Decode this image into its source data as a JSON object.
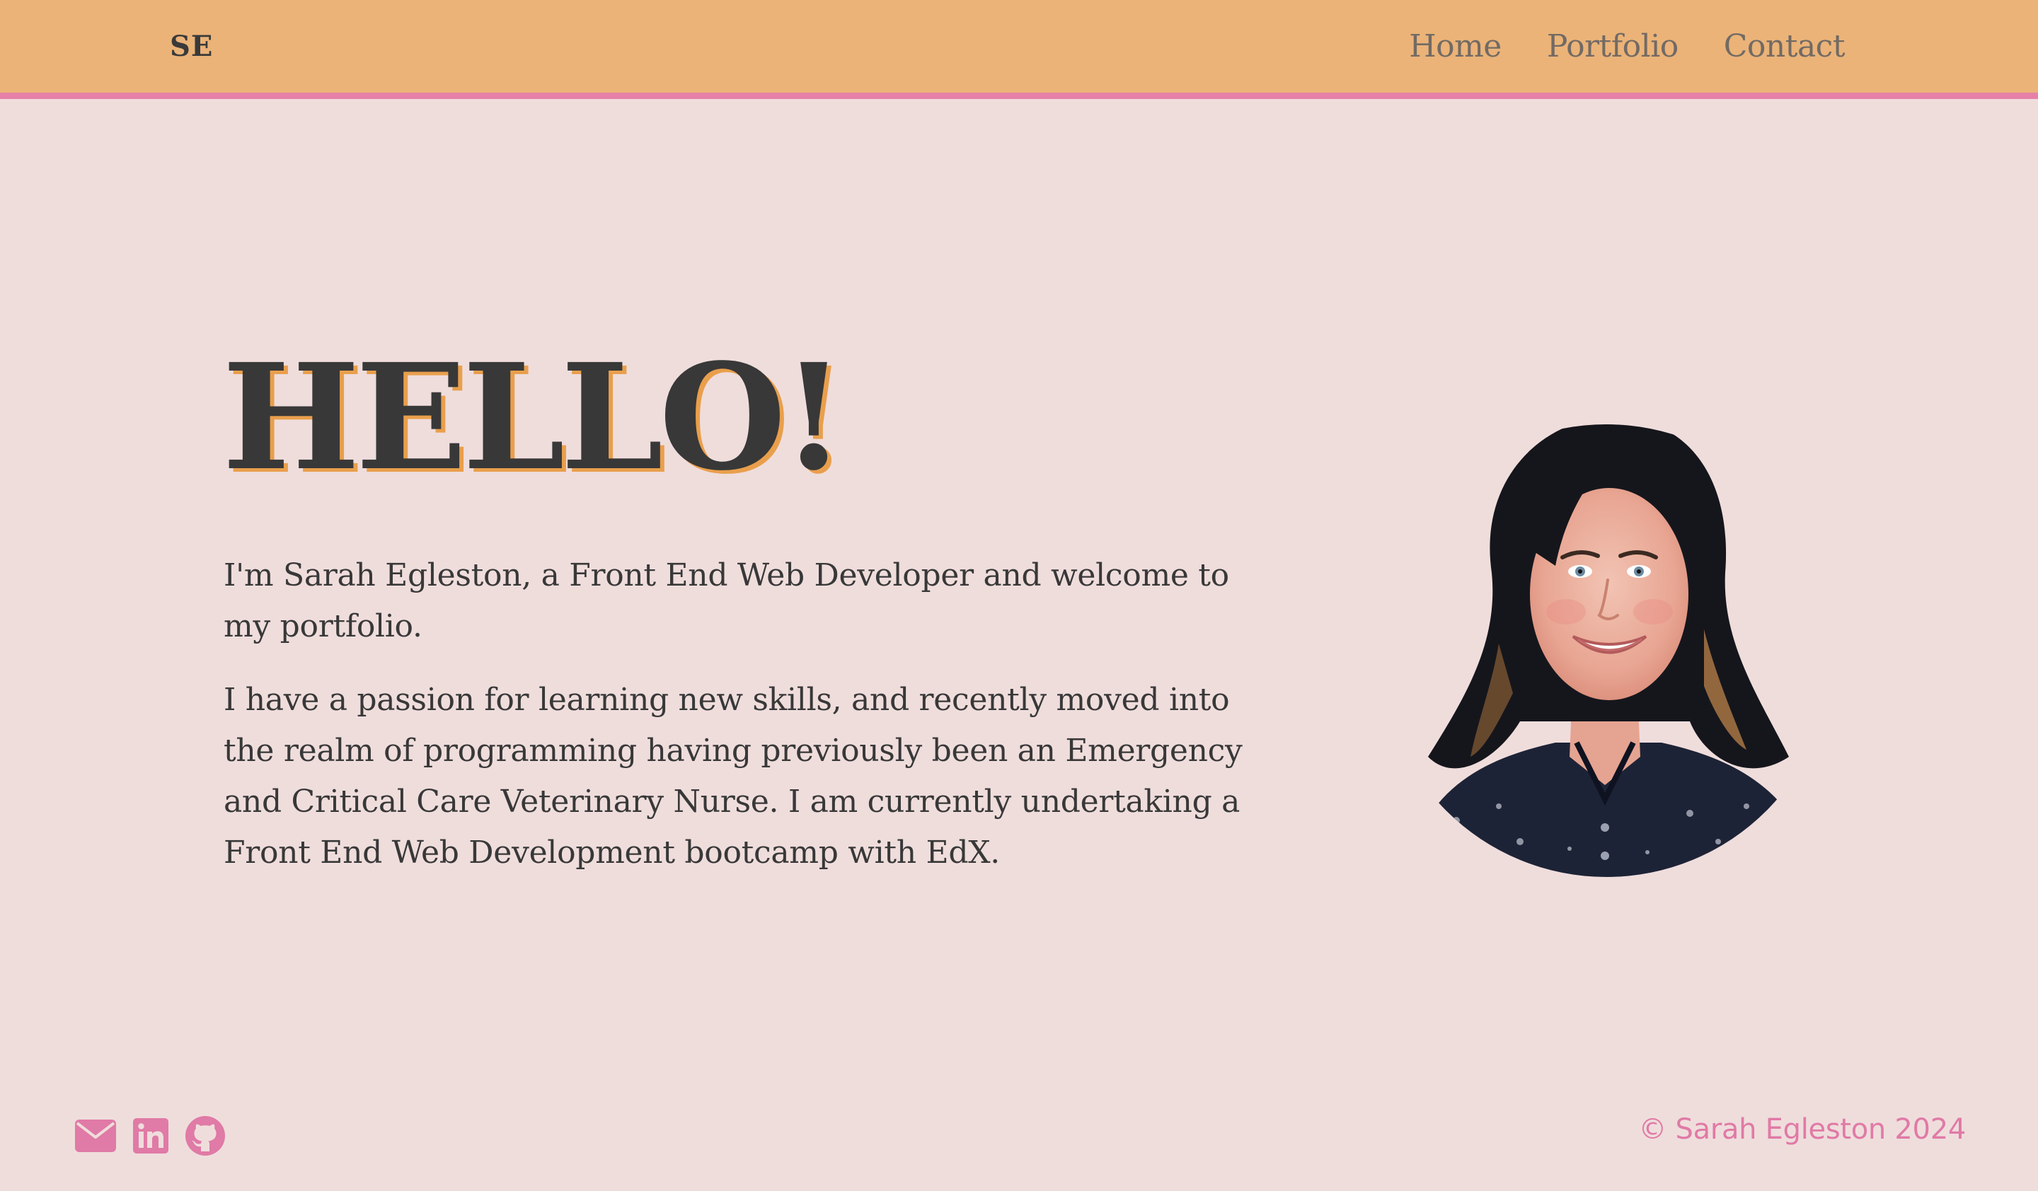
{
  "nav": {
    "brand": "SE",
    "links": [
      "Home",
      "Portfolio",
      "Contact"
    ]
  },
  "hero": {
    "title": "HELLO!",
    "paragraphs": [
      "I'm Sarah Egleston, a Front End Web Developer and welcome to my portfolio.",
      "I have a passion for learning new skills, and recently moved into the realm of programming having previously been an Emergency and Critical Care Veterinary Nurse. I am currently undertaking a Front End Web Development bootcamp with EdX."
    ]
  },
  "footer": {
    "icons": [
      "envelope-icon",
      "linkedin-icon",
      "github-icon"
    ],
    "copyright": "© Sarah Egleston 2024"
  },
  "colors": {
    "background": "#efdddc",
    "navbar": "#ebb378",
    "accent_pink": "#e680a8",
    "title_shadow": "#e99f4c",
    "text": "#383838"
  }
}
